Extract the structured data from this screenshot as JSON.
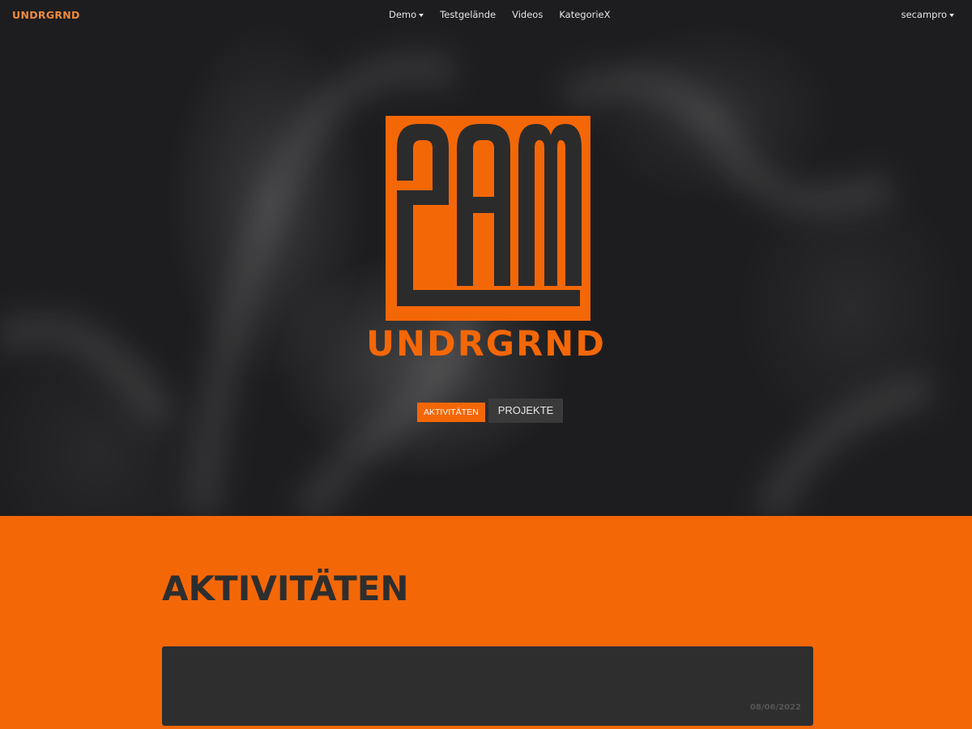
{
  "navbar": {
    "brand": "UNDRGRND",
    "links": [
      {
        "label": "Demo",
        "has_dropdown": true
      },
      {
        "label": "Testgelände",
        "has_dropdown": false
      },
      {
        "label": "Videos",
        "has_dropdown": false
      },
      {
        "label": "KategorieX",
        "has_dropdown": false
      }
    ],
    "user": "secampro"
  },
  "hero": {
    "logo_mark": "2AM",
    "title": "UNDRGRND",
    "buttons": {
      "primary": "AKTIVITÄTEN",
      "secondary": "PROJEKTE"
    }
  },
  "section": {
    "title": "AKTIVITÄTEN",
    "cards": [
      {
        "date": "08/06/2022"
      }
    ]
  },
  "colors": {
    "accent": "#f46707",
    "dark": "#2e2e2e",
    "hero_bg": "#1d1d1f"
  }
}
